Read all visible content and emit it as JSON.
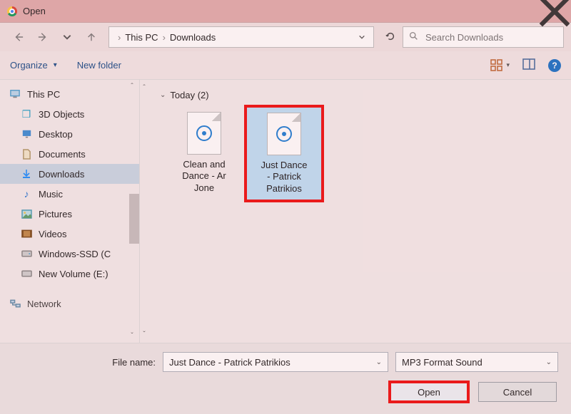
{
  "titlebar": {
    "title": "Open"
  },
  "breadcrumb": {
    "root": "This PC",
    "current": "Downloads"
  },
  "search": {
    "placeholder": "Search Downloads"
  },
  "toolbar": {
    "organize": "Organize",
    "new_folder": "New folder"
  },
  "tree": {
    "root": "This PC",
    "items": [
      {
        "label": "3D Objects",
        "icon": "cube",
        "color": "#2aa6c9"
      },
      {
        "label": "Desktop",
        "icon": "desktop",
        "color": "#2a7bd4"
      },
      {
        "label": "Documents",
        "icon": "doc",
        "color": "#8a6b3a"
      },
      {
        "label": "Downloads",
        "icon": "download",
        "color": "#1e90ff",
        "selected": true
      },
      {
        "label": "Music",
        "icon": "music",
        "color": "#2a7bd4"
      },
      {
        "label": "Pictures",
        "icon": "picture",
        "color": "#2aa6c9"
      },
      {
        "label": "Videos",
        "icon": "video",
        "color": "#7a4a1a"
      },
      {
        "label": "Windows-SSD (C",
        "icon": "drive",
        "color": "#6b6b6b"
      },
      {
        "label": "New Volume (E:)",
        "icon": "drive",
        "color": "#6b6b6b"
      }
    ],
    "overflow": "Network"
  },
  "content": {
    "group_label": "Today (2)",
    "files": [
      {
        "name_l1": "Clean and",
        "name_l2": "Dance - Ar",
        "name_l3": "Jone"
      },
      {
        "name_l1": "Just Dance",
        "name_l2": "- Patrick",
        "name_l3": "Patrikios",
        "selected": true,
        "highlight": true
      }
    ]
  },
  "bottom": {
    "filename_label": "File name:",
    "filename_value": "Just Dance - Patrick Patrikios",
    "filter_value": "MP3 Format Sound",
    "open_label": "Open",
    "cancel_label": "Cancel"
  }
}
